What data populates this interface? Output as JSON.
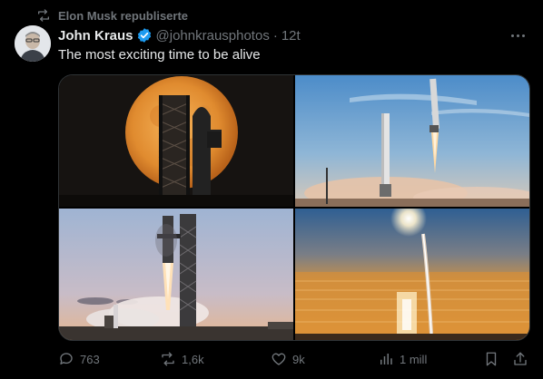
{
  "repost": {
    "label": "Elon Musk republiserte",
    "icon": "repost-icon"
  },
  "author": {
    "name": "John Kraus",
    "handle": "@johnkrausphotos",
    "separator": "·",
    "time": "12t",
    "avatar_icon": "avatar",
    "verified_icon": "verified-badge-icon",
    "verified_color": "#1d9bf0"
  },
  "tweet": {
    "text": "The most exciting time to be alive"
  },
  "media": [
    {
      "icon": "photo-moon-starship"
    },
    {
      "icon": "photo-booster-landing"
    },
    {
      "icon": "photo-booster-catch"
    },
    {
      "icon": "photo-sunset-launch"
    }
  ],
  "actions": {
    "replies": "763",
    "reposts": "1,6k",
    "likes": "9k",
    "views": "1 mill"
  },
  "colors": {
    "background": "#000000",
    "text": "#e7e9ea",
    "muted": "#71767b",
    "border": "#2f3336"
  }
}
